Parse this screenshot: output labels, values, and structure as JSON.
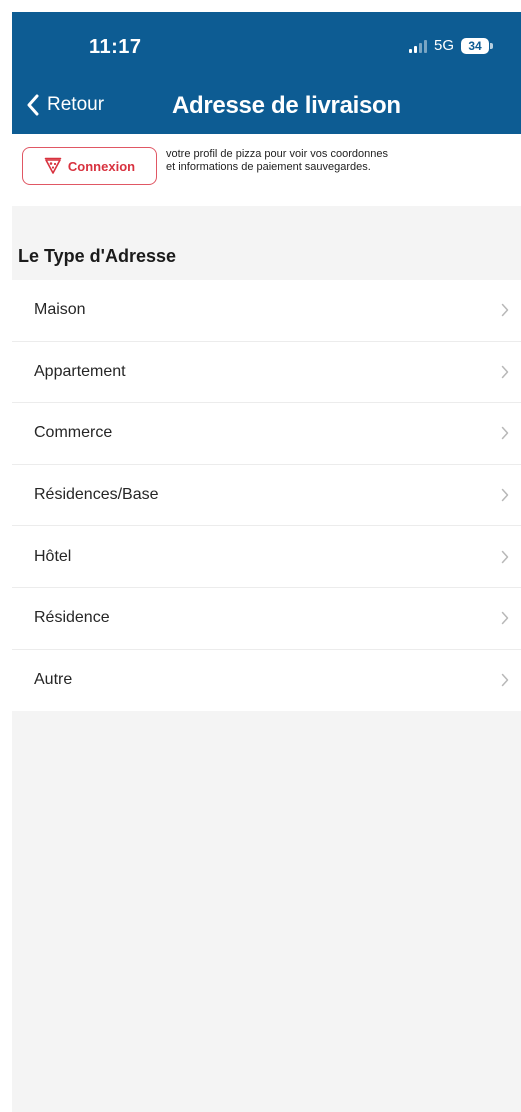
{
  "status_bar": {
    "time": "11:17",
    "network": "5G",
    "battery": "34"
  },
  "nav": {
    "back_label": "Retour",
    "title": "Adresse de livraison"
  },
  "login_banner": {
    "button_label": "Connexion",
    "text": "votre profil de pizza pour voir vos coordonnes et informations de paiement sauvegardes."
  },
  "section": {
    "title": "Le Type d'Adresse"
  },
  "address_types": [
    {
      "label": "Maison"
    },
    {
      "label": "Appartement"
    },
    {
      "label": "Commerce"
    },
    {
      "label": "Résidences/Base"
    },
    {
      "label": "Hôtel"
    },
    {
      "label": "Résidence"
    },
    {
      "label": "Autre"
    }
  ],
  "colors": {
    "header_bg": "#0d5c93",
    "accent_red": "#d8323f",
    "page_bg": "#f4f4f4"
  },
  "icons": {
    "back": "chevron-left-icon",
    "login": "pizza-slice-icon",
    "row": "chevron-right-icon"
  }
}
